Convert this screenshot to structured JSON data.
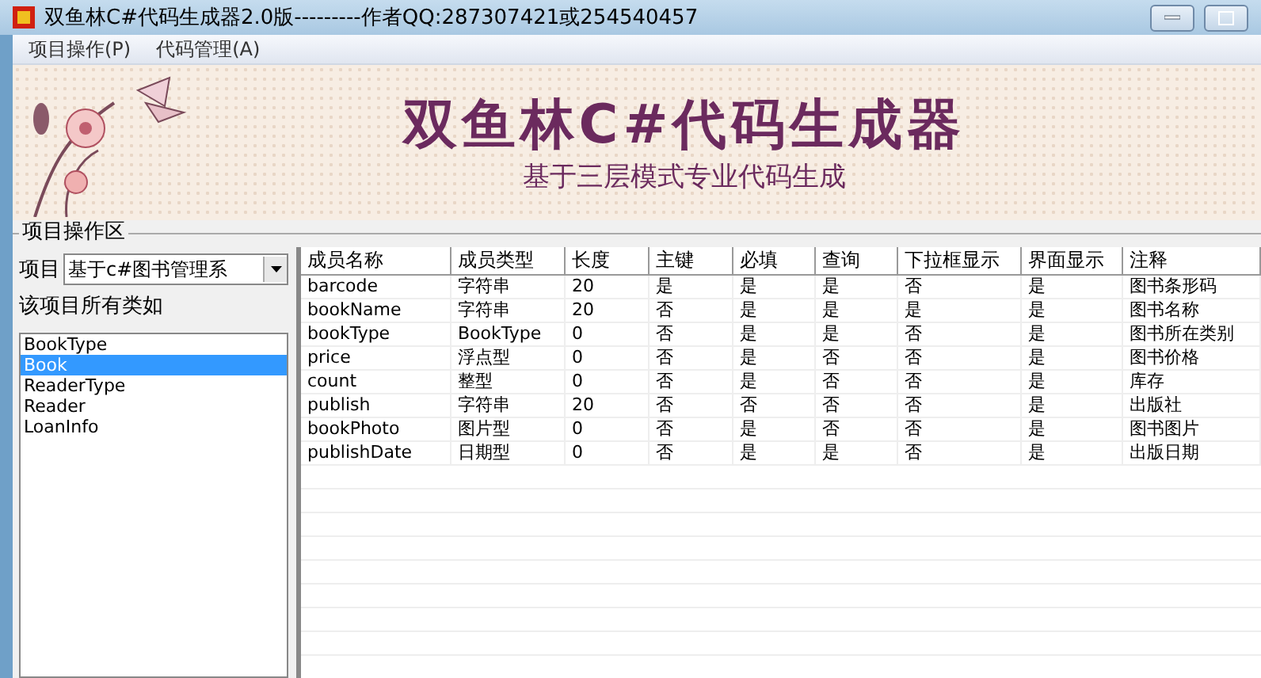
{
  "window": {
    "title": "双鱼林C#代码生成器2.0版---------作者QQ:287307421或254540457"
  },
  "menu": [
    "项目操作(P)",
    "代码管理(A)"
  ],
  "banner": {
    "title": "双鱼林C#代码生成器",
    "subtitle": "基于三层模式专业代码生成"
  },
  "group": {
    "title": "项目操作区"
  },
  "project": {
    "label": "项目",
    "value": "基于c#图书管理系"
  },
  "classes": {
    "label": "该项目所有类如",
    "items": [
      {
        "name": "BookType",
        "selected": false
      },
      {
        "name": "Book",
        "selected": true
      },
      {
        "name": "ReaderType",
        "selected": false
      },
      {
        "name": "Reader",
        "selected": false
      },
      {
        "name": "LoanInfo",
        "selected": false
      }
    ]
  },
  "table": {
    "columns": [
      "成员名称",
      "成员类型",
      "长度",
      "主键",
      "必填",
      "查询",
      "下拉框显示",
      "界面显示",
      "注释"
    ],
    "rows": [
      [
        "barcode",
        "字符串",
        "20",
        "是",
        "是",
        "是",
        "否",
        "是",
        "图书条形码"
      ],
      [
        "bookName",
        "字符串",
        "20",
        "否",
        "是",
        "是",
        "是",
        "是",
        "图书名称"
      ],
      [
        "bookType",
        "BookType",
        "0",
        "否",
        "是",
        "是",
        "否",
        "是",
        "图书所在类别"
      ],
      [
        "price",
        "浮点型",
        "0",
        "否",
        "是",
        "否",
        "否",
        "是",
        "图书价格"
      ],
      [
        "count",
        "整型",
        "0",
        "否",
        "是",
        "否",
        "否",
        "是",
        "库存"
      ],
      [
        "publish",
        "字符串",
        "20",
        "否",
        "否",
        "否",
        "否",
        "是",
        "出版社"
      ],
      [
        "bookPhoto",
        "图片型",
        "0",
        "否",
        "是",
        "否",
        "否",
        "是",
        "图书图片"
      ],
      [
        "publishDate",
        "日期型",
        "0",
        "否",
        "是",
        "是",
        "否",
        "是",
        "出版日期"
      ]
    ]
  }
}
